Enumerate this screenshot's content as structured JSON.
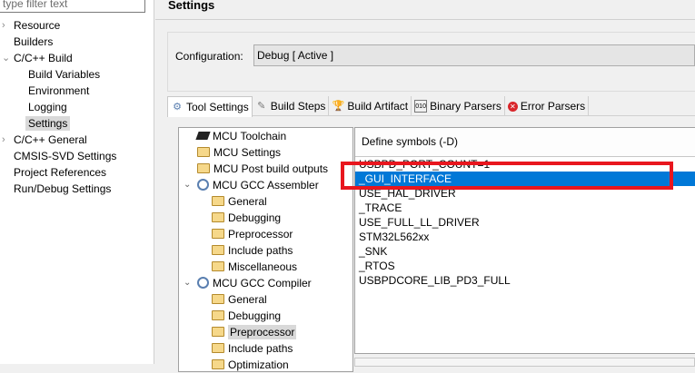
{
  "filter": {
    "placeholder": "type filter text"
  },
  "nav": [
    {
      "label": "Resource",
      "level": 0,
      "chev": "›"
    },
    {
      "label": "Builders",
      "level": 0
    },
    {
      "label": "C/C++ Build",
      "level": 0,
      "chev": "⌄"
    },
    {
      "label": "Build Variables",
      "level": 1
    },
    {
      "label": "Environment",
      "level": 1
    },
    {
      "label": "Logging",
      "level": 1
    },
    {
      "label": "Settings",
      "level": 1,
      "selected": true
    },
    {
      "label": "C/C++ General",
      "level": 0,
      "chev": "›"
    },
    {
      "label": "CMSIS-SVD Settings",
      "level": 0
    },
    {
      "label": "Project References",
      "level": 0
    },
    {
      "label": "Run/Debug Settings",
      "level": 0
    }
  ],
  "page_title": "Settings",
  "configuration": {
    "label": "Configuration:",
    "value": "Debug  [ Active ]"
  },
  "tabs": [
    "Tool Settings",
    "Build Steps",
    "Build Artifact",
    "Binary Parsers",
    "Error Parsers"
  ],
  "tree": [
    {
      "label": "MCU Toolchain",
      "icon": "chip"
    },
    {
      "label": "MCU Settings",
      "icon": "folder"
    },
    {
      "label": "MCU Post build outputs",
      "icon": "folder"
    },
    {
      "label": "MCU GCC Assembler",
      "icon": "gear",
      "expanded": true
    },
    {
      "label": "General",
      "icon": "folder",
      "child": true
    },
    {
      "label": "Debugging",
      "icon": "folder",
      "child": true
    },
    {
      "label": "Preprocessor",
      "icon": "folder",
      "child": true
    },
    {
      "label": "Include paths",
      "icon": "folder",
      "child": true
    },
    {
      "label": "Miscellaneous",
      "icon": "folder",
      "child": true
    },
    {
      "label": "MCU GCC Compiler",
      "icon": "gear",
      "expanded": true
    },
    {
      "label": "General",
      "icon": "folder",
      "child": true
    },
    {
      "label": "Debugging",
      "icon": "folder",
      "child": true
    },
    {
      "label": "Preprocessor",
      "icon": "folder",
      "child": true,
      "selected": true
    },
    {
      "label": "Include paths",
      "icon": "folder",
      "child": true
    },
    {
      "label": "Optimization",
      "icon": "folder",
      "child": true
    }
  ],
  "symbols": {
    "header": "Define symbols (-D)",
    "items": [
      "USBPD_PORT_COUNT=1",
      "_GUI_INTERFACE",
      "USE_HAL_DRIVER",
      "_TRACE",
      "USE_FULL_LL_DRIVER",
      "STM32L562xx",
      "_SNK",
      "_RTOS",
      "USBPDCORE_LIB_PD3_FULL"
    ],
    "selected_index": 1
  },
  "colors": {
    "selection": "#0078d7",
    "highlight_box": "#e8161e"
  }
}
